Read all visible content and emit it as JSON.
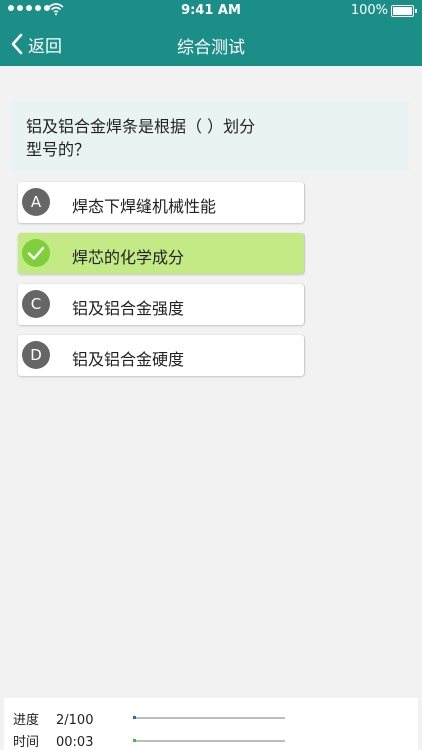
{
  "status_bar": {
    "time": "9:41 AM",
    "battery": "100%"
  },
  "nav": {
    "back_label": "返回",
    "title": "综合测试"
  },
  "question": {
    "text": "铝及铝合金焊条是根据（ ）划分型号的？"
  },
  "options": [
    {
      "letter": "A",
      "text": "焊态下焊缝机械性能",
      "selected": false
    },
    {
      "letter": "",
      "text": "焊芯的化学成分",
      "selected": true
    },
    {
      "letter": "C",
      "text": "铝及铝合金强度",
      "selected": false
    },
    {
      "letter": "D",
      "text": "铝及铝合金硬度",
      "selected": false
    }
  ],
  "footer": {
    "progress_label": "进度",
    "progress_value": "2/100",
    "progress_fraction": 0.02,
    "time_label": "时间",
    "time_value": "00:03",
    "time_fraction": 0.02
  },
  "colors": {
    "header": "#1b8f87",
    "selected_option": "#c4ea86",
    "check_badge": "#7fcf3c",
    "progress_fill": "#1f6fc2",
    "time_fill": "#3cbf3c"
  },
  "icons": {
    "back": "chevron-left-icon",
    "correct": "check-icon"
  }
}
